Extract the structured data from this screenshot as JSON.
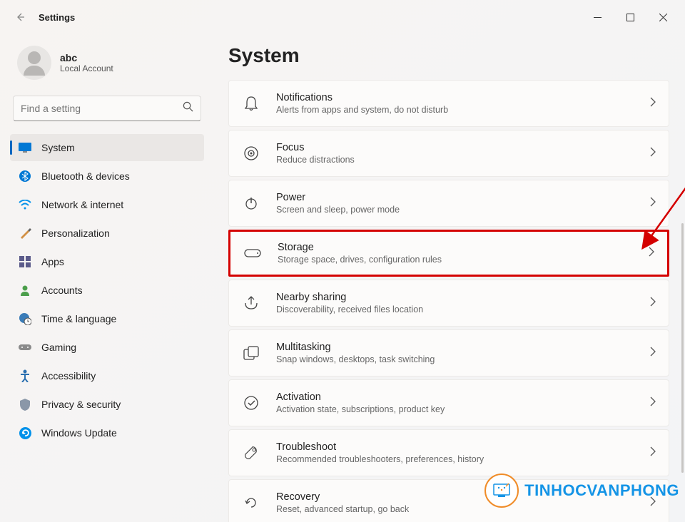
{
  "window": {
    "title": "Settings"
  },
  "account": {
    "name": "abc",
    "type": "Local Account"
  },
  "search": {
    "placeholder": "Find a setting"
  },
  "nav": {
    "items": [
      {
        "label": "System",
        "icon": "display-icon",
        "active": true
      },
      {
        "label": "Bluetooth & devices",
        "icon": "bluetooth-icon"
      },
      {
        "label": "Network & internet",
        "icon": "wifi-icon"
      },
      {
        "label": "Personalization",
        "icon": "brush-icon"
      },
      {
        "label": "Apps",
        "icon": "apps-icon"
      },
      {
        "label": "Accounts",
        "icon": "person-icon"
      },
      {
        "label": "Time & language",
        "icon": "globe-clock-icon"
      },
      {
        "label": "Gaming",
        "icon": "gamepad-icon"
      },
      {
        "label": "Accessibility",
        "icon": "accessibility-icon"
      },
      {
        "label": "Privacy & security",
        "icon": "shield-icon"
      },
      {
        "label": "Windows Update",
        "icon": "update-icon"
      }
    ]
  },
  "page": {
    "title": "System"
  },
  "cards": [
    {
      "title": "Notifications",
      "sub": "Alerts from apps and system, do not disturb",
      "icon": "bell-icon"
    },
    {
      "title": "Focus",
      "sub": "Reduce distractions",
      "icon": "focus-icon"
    },
    {
      "title": "Power",
      "sub": "Screen and sleep, power mode",
      "icon": "power-icon"
    },
    {
      "title": "Storage",
      "sub": "Storage space, drives, configuration rules",
      "icon": "drive-icon",
      "highlight": true
    },
    {
      "title": "Nearby sharing",
      "sub": "Discoverability, received files location",
      "icon": "share-icon"
    },
    {
      "title": "Multitasking",
      "sub": "Snap windows, desktops, task switching",
      "icon": "multitask-icon"
    },
    {
      "title": "Activation",
      "sub": "Activation state, subscriptions, product key",
      "icon": "check-circle-icon"
    },
    {
      "title": "Troubleshoot",
      "sub": "Recommended troubleshooters, preferences, history",
      "icon": "wrench-icon"
    },
    {
      "title": "Recovery",
      "sub": "Reset, advanced startup, go back",
      "icon": "recovery-icon"
    }
  ],
  "watermark": {
    "text": "TINHOCVANPHONG"
  },
  "annotation": {
    "arrow_color": "#d40000"
  }
}
